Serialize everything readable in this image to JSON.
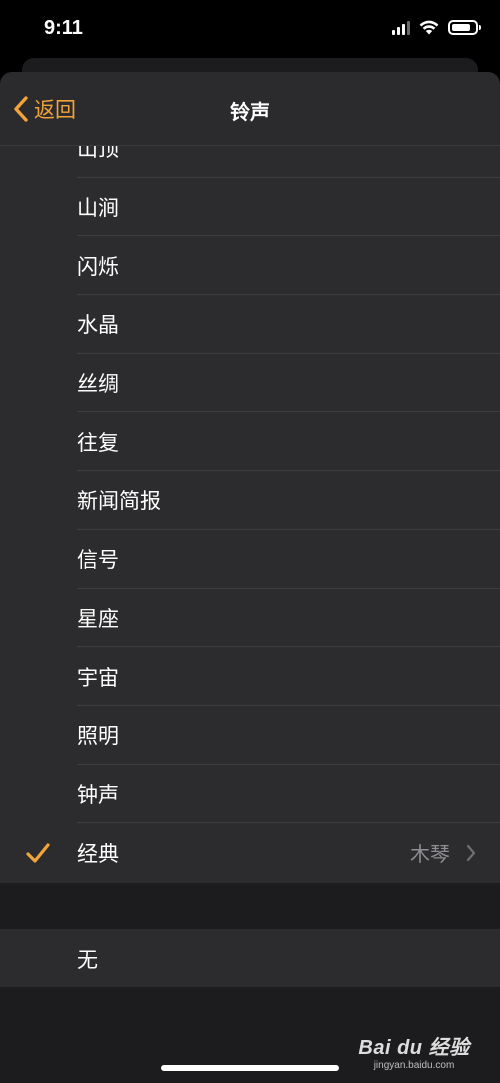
{
  "status": {
    "time": "9:11"
  },
  "nav": {
    "back_label": "返回",
    "title": "铃声"
  },
  "tones": [
    {
      "label": "山顶"
    },
    {
      "label": "山涧"
    },
    {
      "label": "闪烁"
    },
    {
      "label": "水晶"
    },
    {
      "label": "丝绸"
    },
    {
      "label": "往复"
    },
    {
      "label": "新闻简报"
    },
    {
      "label": "信号"
    },
    {
      "label": "星座"
    },
    {
      "label": "宇宙"
    },
    {
      "label": "照明"
    },
    {
      "label": "钟声"
    },
    {
      "label": "经典",
      "detail": "木琴",
      "selected": true
    }
  ],
  "none_option": {
    "label": "无"
  },
  "watermark": {
    "logo": "Bai du 经验",
    "url": "jingyan.baidu.com"
  },
  "colors": {
    "accent": "#f2a33a",
    "row_bg": "#2c2c2e",
    "page_bg": "#1c1c1e"
  }
}
